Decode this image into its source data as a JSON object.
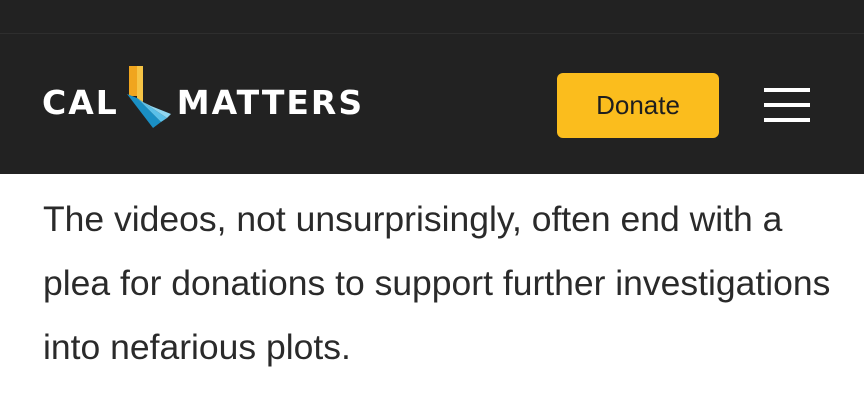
{
  "header": {
    "logo_left": "CAL",
    "logo_right": "MATTERS",
    "donate_label": "Donate",
    "menu_icon": "hamburger-menu-icon"
  },
  "colors": {
    "header_bg": "#222222",
    "donate_bg": "#fbbd1d",
    "text": "#2a2a2a"
  },
  "article": {
    "paragraph": "The videos, not unsurprisingly, often end with a plea for donations to support further investigations into nefarious plots."
  }
}
